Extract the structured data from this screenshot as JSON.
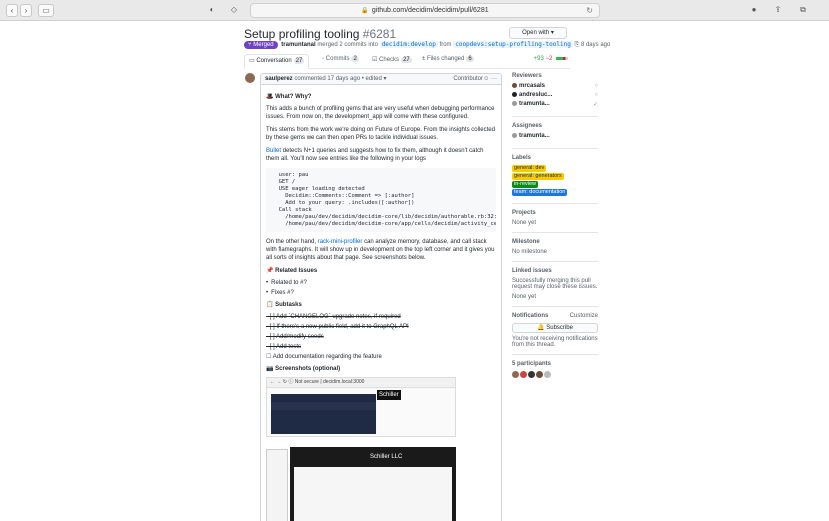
{
  "browser": {
    "url": "github.com/decidim/decidim/pull/6281"
  },
  "pr": {
    "title": "Setup profiling tooling",
    "number": "#6281",
    "open_with": "Open with",
    "state": "Merged",
    "author": "tramuntanal",
    "merge_text": "merged 2 commits into",
    "base_branch": "decidim:develop",
    "from_text": "from",
    "head_branch": "coopdevs:setup-profiling-tooling",
    "when": "8 days ago"
  },
  "tabs": [
    {
      "label": "Conversation",
      "count": "27"
    },
    {
      "label": "Commits",
      "count": "2"
    },
    {
      "label": "Checks",
      "count": "27"
    },
    {
      "label": "Files changed",
      "count": "6"
    }
  ],
  "diffstat": {
    "additions": "+93",
    "deletions": "−2"
  },
  "comment": {
    "author": "saulperez",
    "meta": "commented 17 days ago • edited",
    "badge": "Contributor",
    "what_why": "What? Why?",
    "p1": "This adds a bunch of profiling gems that are very useful when debugging performance issues. From now on, the development_app will come with these configured.",
    "p2": "This stems from the work we're doing on Future of Europe. From the insights collected by these gems we can then open PRs to tackle individual issues.",
    "p3_link": "Bullet",
    "p3": "detects N+1 queries and suggests how to fix them, although it doesn't catch them all. You'll now see entries like the following in your logs",
    "code": "  user: pau\n  GET /\n  USE eager loading detected\n    Decidim::Comments::Comment => [:author]\n    Add to your query: .includes([:author])\n  Call stack\n    /home/pau/dev/decidim/decidim-core/lib/decidim/authorable.rb:32:in `\n    /home/pau/dev/decidim/decidim-core/app/cells/decidim/activity_cell.r",
    "p4_pre": "On the other hand,",
    "p4_link": "rack-mini-profiler",
    "p4": "can analyze memory, database, and call stack with flamegraphs. It will show up in development on the top left corner and it gives you all sorts of insights about that page. See screenshots below.",
    "related_title": "Related Issues",
    "related": [
      "Related to #?",
      "Fixes #?"
    ],
    "subtasks_title": "Subtasks",
    "subtasks_done": [
      "Add `CHANGELOG` upgrade notes, if required",
      "If there's a new public field, add it to GraphQL API",
      "Add/modify seeds",
      "Add tests"
    ],
    "subtask_open": "Add documentation regarding the feature",
    "screens_title": "Screenshots (optional)",
    "shot1_url": "Not secure | decidim.local:3000",
    "shot1_brand": "Schiller",
    "shot2_brand": "Schiller LLC"
  },
  "sidebar": {
    "reviewers_title": "Reviewers",
    "reviewers": [
      {
        "name": "mrcasals"
      },
      {
        "name": "andresluc..."
      },
      {
        "name": "tramunta..."
      }
    ],
    "assignees_title": "Assignees",
    "assignee": "tramunta...",
    "labels_title": "Labels",
    "labels": [
      {
        "text": "general: dev",
        "bg": "#fbca04",
        "fg": "#24292e"
      },
      {
        "text": "general: generators",
        "bg": "#fbca04",
        "fg": "#24292e"
      },
      {
        "text": "in-review",
        "bg": "#0e8a16",
        "fg": "#ffffff"
      },
      {
        "text": "team: documentation",
        "bg": "#1d76db",
        "fg": "#ffffff"
      }
    ],
    "projects_title": "Projects",
    "projects_value": "None yet",
    "milestone_title": "Milestone",
    "milestone_value": "No milestone",
    "linked_title": "Linked issues",
    "linked_text": "Successfully merging this pull request may close these issues.",
    "linked_value": "None yet",
    "notif_title": "Notifications",
    "customize": "Customize",
    "subscribe": "Subscribe",
    "notif_text": "You're not receiving notifications from this thread.",
    "participants_title": "5 participants"
  }
}
